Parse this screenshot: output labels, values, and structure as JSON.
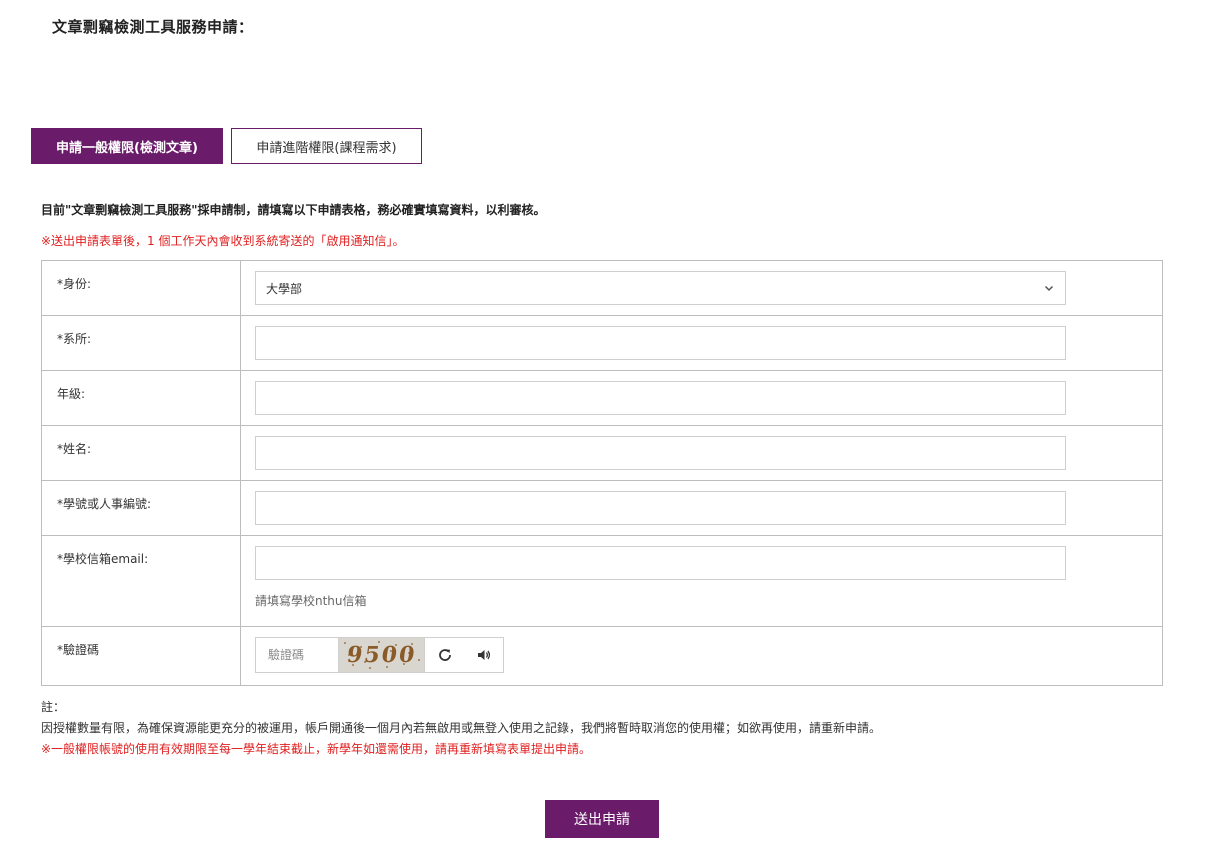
{
  "page": {
    "title": "文章剽竊檢測工具服務申請："
  },
  "tabs": [
    {
      "label": "申請一般權限(檢測文章)",
      "active": true
    },
    {
      "label": "申請進階權限(課程需求)",
      "active": false
    }
  ],
  "intro": "目前\"文章剽竊檢測工具服務\"採申請制，請填寫以下申請表格，務必確實填寫資料，以利審核。",
  "notice": "※送出申請表單後，1 個工作天內會收到系統寄送的「啟用通知信」。",
  "form": {
    "identity": {
      "label": "*身份:",
      "value": "大學部"
    },
    "department": {
      "label": "*系所:",
      "value": ""
    },
    "grade": {
      "label": "年級:",
      "value": ""
    },
    "name": {
      "label": "*姓名:",
      "value": ""
    },
    "student_id": {
      "label": "*學號或人事編號:",
      "value": ""
    },
    "email": {
      "label": "*學校信箱email:",
      "value": "",
      "hint": "請填寫學校nthu信箱"
    },
    "captcha": {
      "label": "*驗證碼",
      "placeholder": "驗證碼",
      "image_text": "9500"
    }
  },
  "notes": {
    "heading": "註：",
    "line1": "因授權數量有限，為確保資源能更充分的被運用，帳戶開通後一個月內若無啟用或無登入使用之記錄，我們將暫時取消您的使用權；如欲再使用，請重新申請。",
    "line2": "※一般權限帳號的使用有效期限至每一學年結束截止，新學年如還需使用，請再重新填寫表單提出申請。"
  },
  "submit_label": "送出申請",
  "colors": {
    "brand": "#6a1b6a",
    "warning": "#e02020",
    "border": "#bdbdbd"
  },
  "icons": [
    "chevron-down-icon",
    "refresh-icon",
    "speaker-icon"
  ]
}
